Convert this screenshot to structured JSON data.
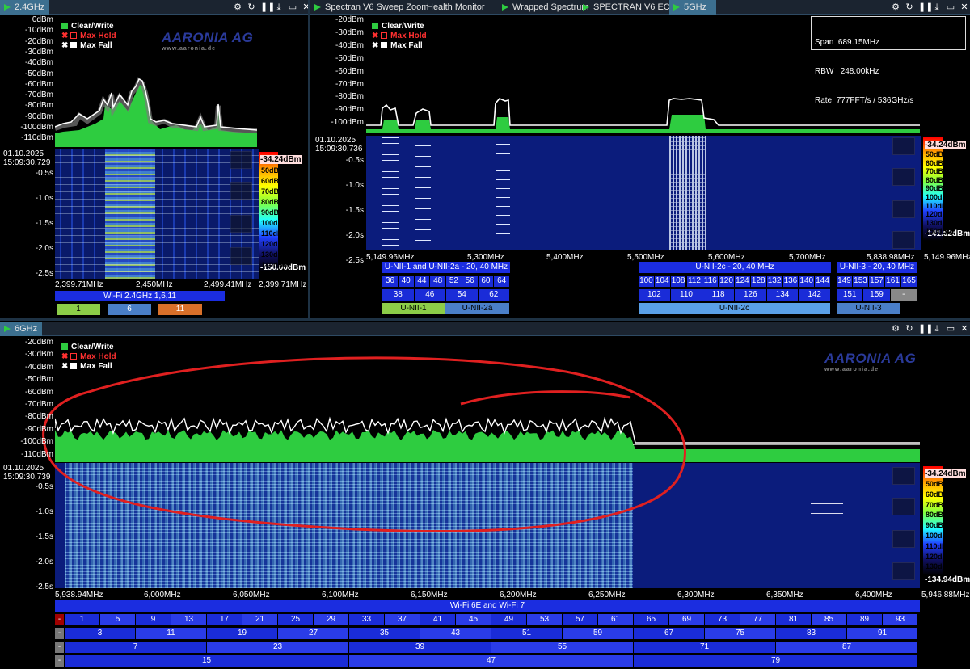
{
  "tabs_top_left": [
    {
      "label": "2.4GHz",
      "active": true
    }
  ],
  "tabs_top_right": [
    {
      "label": "Spectran V6 Sweep Zoom",
      "play": true
    },
    {
      "label": "Health Monitor",
      "play": false
    },
    {
      "label": "Wrapped Spectrum",
      "play": true
    },
    {
      "label": "SPECTRAN V6 ECO",
      "play": true
    },
    {
      "label": "5GHz",
      "play": true,
      "active": true
    }
  ],
  "tabs_bottom": [
    {
      "label": "6GHz",
      "active": true
    }
  ],
  "legend": {
    "clear_write": "Clear/Write",
    "max_hold": "Max Hold",
    "max_fall": "Max Fall"
  },
  "logo": {
    "name": "AARONIA AG",
    "url": "www.aaronia.de"
  },
  "colors": {
    "clear_write": "#2ecc40",
    "max_hold": "#ff3030",
    "max_fall": "#ffffff",
    "annotation": "#e02020"
  },
  "panel24": {
    "y_labels": [
      "0dBm",
      "-10dBm",
      "-20dBm",
      "-30dBm",
      "-40dBm",
      "-50dBm",
      "-60dBm",
      "-70dBm",
      "-80dBm",
      "-90dBm",
      "-100dBm",
      "-110dBm"
    ],
    "date": "01.10.2025",
    "time": "15:09:30.729",
    "t_labels": [
      "-0.5s",
      "-1.0s",
      "-1.5s",
      "-2.0s",
      "-2.5s"
    ],
    "cb_top": "-34.24dBm",
    "cb_bottom": "-150.00dBm",
    "cb_ticks": [
      "50dBm",
      "60dBm",
      "70dBm",
      "80dBm",
      "90dBm",
      "100dBm",
      "110dBm",
      "120dBm",
      "130dBm",
      "140dBm"
    ],
    "x_labels": [
      "2,399.71MHz",
      "2,450MHz",
      "2,499.41MHz"
    ],
    "x_right": "2,399.71MHz",
    "band_label": "Wi-Fi 2.4GHz 1,6,11",
    "channels": [
      "1",
      "6",
      "11"
    ]
  },
  "panel5": {
    "y_labels": [
      "-20dBm",
      "-30dBm",
      "-40dBm",
      "-50dBm",
      "-60dBm",
      "-70dBm",
      "-80dBm",
      "-90dBm",
      "-100dBm"
    ],
    "info": {
      "span_label": "Span",
      "span": "689.15MHz",
      "rbw_label": "RBW",
      "rbw": "248.00kHz",
      "rate_label": "Rate",
      "rate": "777FFT/s / 536GHz/s"
    },
    "date": "01.10.2025",
    "time": "15:09:30.736",
    "t_labels": [
      "-0.5s",
      "-1.0s",
      "-1.5s",
      "-2.0s",
      "-2.5s"
    ],
    "cb_top": "-34.24dBm",
    "cb_bottom": "-141.62dBm",
    "cb_ticks": [
      "50dBm",
      "60dBm",
      "70dBm",
      "80dBm",
      "90dBm",
      "100dBm",
      "110dBm",
      "120dBm",
      "130dBm",
      "150dBm"
    ],
    "x_labels": [
      "5,149.96MHz",
      "5,300MHz",
      "5,400MHz",
      "5,500MHz",
      "5,600MHz",
      "5,700MHz",
      "5,838.98MHz"
    ],
    "x_right": "5,149.96MHz",
    "groups": [
      {
        "title": "U-NII-1 and U-NII-2a - 20, 40 MHz",
        "row1": [
          "36",
          "40",
          "44",
          "48",
          "52",
          "56",
          "60",
          "64"
        ],
        "row2": [
          "38",
          "46",
          "54",
          "62"
        ]
      },
      {
        "title": "U-NII-2c - 20, 40 MHz",
        "row1": [
          "100",
          "104",
          "108",
          "112",
          "116",
          "120",
          "124",
          "128",
          "132",
          "136",
          "140",
          "144"
        ],
        "row2": [
          "102",
          "110",
          "118",
          "126",
          "134",
          "142"
        ]
      },
      {
        "title": "U-NII-3 - 20, 40 MHz",
        "row1": [
          "149",
          "153",
          "157",
          "161",
          "165"
        ],
        "row2": [
          "151",
          "159"
        ]
      }
    ],
    "bands": [
      "U-NII-1",
      "U-NII-2a",
      "U-NII-2c",
      "U-NII-3"
    ],
    "dash": "-"
  },
  "panel6": {
    "y_labels": [
      "-20dBm",
      "-30dBm",
      "-40dBm",
      "-50dBm",
      "-60dBm",
      "-70dBm",
      "-80dBm",
      "-90dBm",
      "-100dBm",
      "-110dBm"
    ],
    "date": "01.10.2025",
    "time": "15:09:30.739",
    "t_labels": [
      "-0.5s",
      "-1.0s",
      "-1.5s",
      "-2.0s",
      "-2.5s"
    ],
    "cb_top": "-34.24dBm",
    "cb_bottom": "-134.94dBm",
    "cb_ticks": [
      "50dBm",
      "60dBm",
      "70dBm",
      "80dBm",
      "90dBm",
      "100dBm",
      "110dBm",
      "120dBm",
      "130dBm"
    ],
    "x_labels": [
      "5,938.94MHz",
      "6,000MHz",
      "6,050MHz",
      "6,100MHz",
      "6,150MHz",
      "6,200MHz",
      "6,250MHz",
      "6,300MHz",
      "6,350MHz",
      "6,400MHz"
    ],
    "x_right": "5,946.88MHz",
    "title": "Wi-Fi 6E and Wi-Fi 7",
    "row20": [
      "1",
      "5",
      "9",
      "13",
      "17",
      "21",
      "25",
      "29",
      "33",
      "37",
      "41",
      "45",
      "49",
      "53",
      "57",
      "61",
      "65",
      "69",
      "73",
      "77",
      "81",
      "85",
      "89",
      "93"
    ],
    "row40": [
      "3",
      "11",
      "19",
      "27",
      "35",
      "43",
      "51",
      "59",
      "67",
      "75",
      "83",
      "91"
    ],
    "row80": [
      "7",
      "23",
      "39",
      "55",
      "71",
      "87"
    ],
    "row160": [
      "15",
      "47",
      "79"
    ],
    "dash": "-"
  }
}
